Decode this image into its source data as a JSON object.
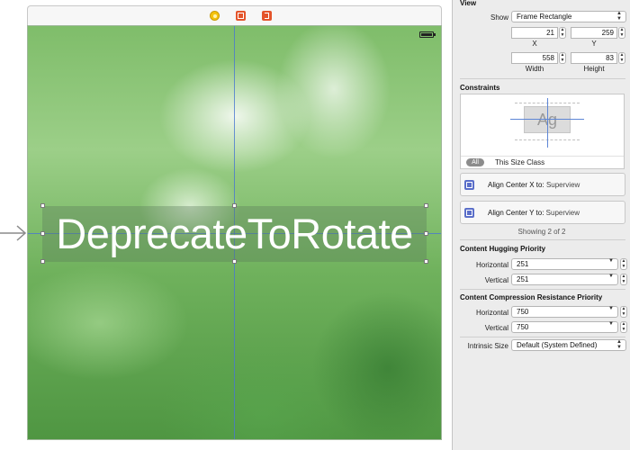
{
  "canvas": {
    "scene_label": "DeprecateToRotate"
  },
  "inspector": {
    "view": {
      "section_title": "View",
      "show_label": "Show",
      "show_value": "Frame Rectangle",
      "x_value": "21",
      "y_value": "259",
      "width_value": "558",
      "height_value": "83",
      "x_label": "X",
      "y_label": "Y",
      "width_label": "Width",
      "height_label": "Height"
    },
    "constraints": {
      "section_title": "Constraints",
      "preview_text": "Ag",
      "all_label": "All",
      "size_class_label": "This Size Class",
      "items": [
        {
          "name": "Align Center X to:",
          "target": "Superview"
        },
        {
          "name": "Align Center Y to:",
          "target": "Superview"
        }
      ],
      "showing_text": "Showing 2 of 2"
    },
    "hugging": {
      "section_title": "Content Hugging Priority",
      "horizontal_label": "Horizontal",
      "horizontal_value": "251",
      "vertical_label": "Vertical",
      "vertical_value": "251"
    },
    "compression": {
      "section_title": "Content Compression Resistance Priority",
      "horizontal_label": "Horizontal",
      "horizontal_value": "750",
      "vertical_label": "Vertical",
      "vertical_value": "750"
    },
    "intrinsic": {
      "label": "Intrinsic Size",
      "value": "Default (System Defined)"
    }
  },
  "colors": {
    "guide_blue": "#4a78d0",
    "constraint_icon": "#5b6fc9"
  }
}
